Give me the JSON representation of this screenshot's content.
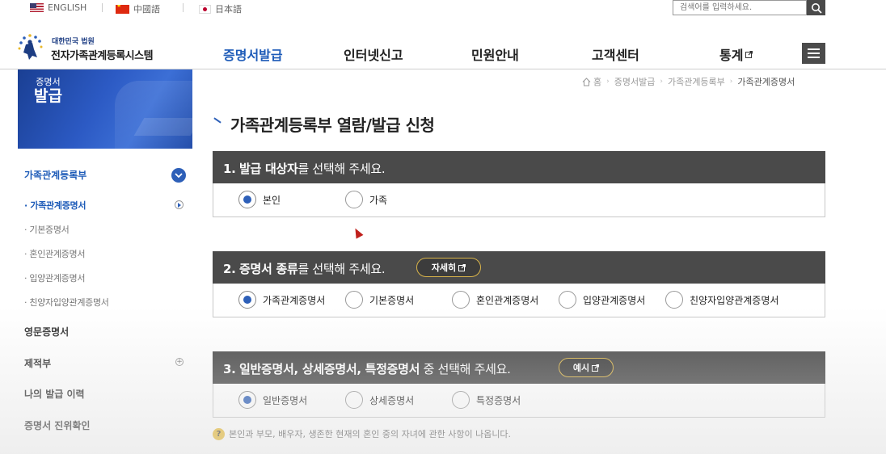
{
  "languages": [
    {
      "label": "ENGLISH",
      "flag": "us-flag-icon"
    },
    {
      "label": "中國語",
      "flag": "china-flag-icon"
    },
    {
      "label": "日本語",
      "flag": "japan-flag-icon"
    }
  ],
  "search": {
    "placeholder": "검색어를 입력하세요."
  },
  "logo": {
    "sub": "대한민국 법원",
    "title": "전자가족관계등록시스템"
  },
  "gnb": [
    {
      "label": "증명서발급",
      "active": true
    },
    {
      "label": "인터넷신고"
    },
    {
      "label": "민원안내"
    },
    {
      "label": "고객센터"
    },
    {
      "label": "통계",
      "external": true
    }
  ],
  "banner": {
    "line1": "증명서",
    "line2": "발급"
  },
  "lnb": {
    "section_title": "가족관계등록부",
    "sub_items": [
      {
        "label": "· 가족관계증명서",
        "active": true
      },
      {
        "label": "· 기본증명서"
      },
      {
        "label": "· 혼인관계증명서"
      },
      {
        "label": "· 입양관계증명서"
      },
      {
        "label": "· 친양자입양관계증명서"
      }
    ],
    "main_items": [
      {
        "label": "영문증명서"
      },
      {
        "label": "제적부"
      },
      {
        "label": "나의 발급 이력"
      },
      {
        "label": "증명서 진위확인"
      }
    ]
  },
  "breadcrumb": {
    "home": "홈",
    "items": [
      "증명서발급",
      "가족관계등록부"
    ],
    "current": "가족관계증명서"
  },
  "page_title": "가족관계등록부 열람/발급 신청",
  "sections": [
    {
      "number": "1.",
      "bold": "발급 대상자",
      "rest": "를 선택해 주세요.",
      "options": [
        {
          "label": "본인",
          "checked": true
        },
        {
          "label": "가족"
        }
      ]
    },
    {
      "number": "2.",
      "bold": "증명서 종류",
      "rest": "를 선택해 주세요.",
      "button": "자세히",
      "options": [
        {
          "label": "가족관계증명서",
          "checked": true
        },
        {
          "label": "기본증명서"
        },
        {
          "label": "혼인관계증명서"
        },
        {
          "label": "입양관계증명서"
        },
        {
          "label": "친양자입양관계증명서"
        }
      ]
    },
    {
      "number": "3.",
      "bold": "일반증명서, 상세증명서, 특정증명서",
      "rest": " 중 선택해 주세요.",
      "button": "예시",
      "options": [
        {
          "label": "일반증명서",
          "checked": true
        },
        {
          "label": "상세증명서"
        },
        {
          "label": "특정증명서"
        }
      ]
    }
  ],
  "note": "본인과 부모, 배우자, 생존한 현재의 혼인 중의 자녀에 관한 사항이 나옵니다.",
  "colors": {
    "primary": "#1d5bb8",
    "section_header": "#4a4a4a",
    "pill_border": "#d9b44a",
    "radio_dot": "#2d5fb8"
  }
}
